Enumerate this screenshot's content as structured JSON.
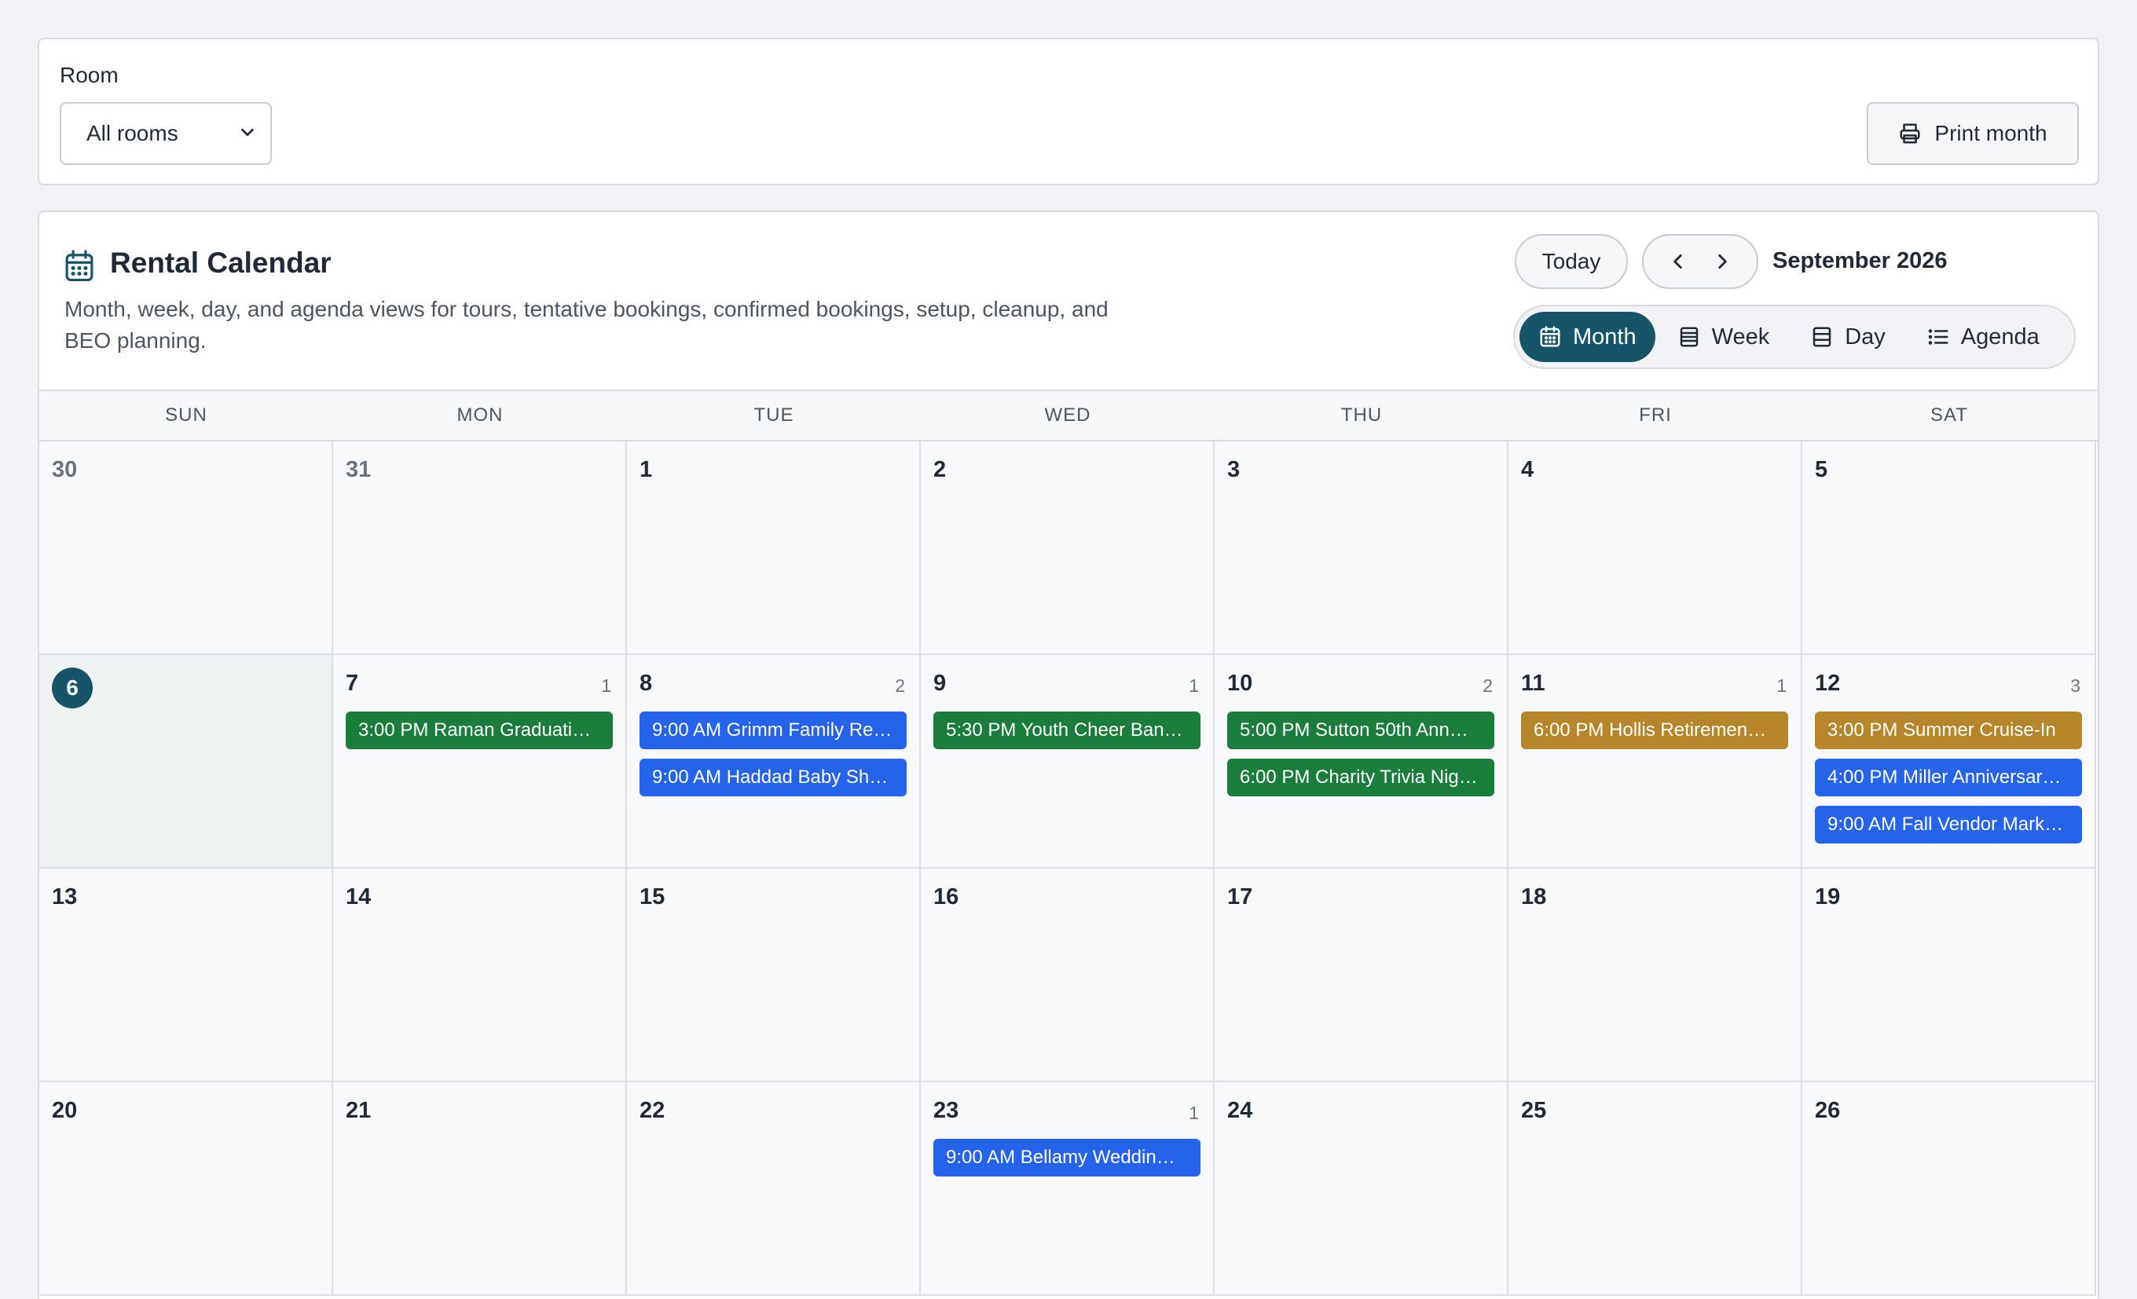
{
  "filter": {
    "room_label": "Room",
    "room_value": "All rooms",
    "print_label": "Print month"
  },
  "calendar": {
    "title": "Rental Calendar",
    "description": "Month, week, day, and agenda views for tours, tentative bookings, confirmed bookings, setup, cleanup, and BEO planning.",
    "today_label": "Today",
    "month_label": "September 2026",
    "views": [
      {
        "label": "Month",
        "icon": "calendar-icon",
        "active": true
      },
      {
        "label": "Week",
        "icon": "week-icon",
        "active": false
      },
      {
        "label": "Day",
        "icon": "day-icon",
        "active": false
      },
      {
        "label": "Agenda",
        "icon": "list-icon",
        "active": false
      }
    ],
    "weekdays": [
      "SUN",
      "MON",
      "TUE",
      "WED",
      "THU",
      "FRI",
      "SAT"
    ],
    "weeks": [
      [
        {
          "day": "30",
          "muted": true,
          "count": "",
          "events": []
        },
        {
          "day": "31",
          "muted": true,
          "count": "",
          "events": []
        },
        {
          "day": "1",
          "count": "",
          "events": []
        },
        {
          "day": "2",
          "count": "",
          "events": []
        },
        {
          "day": "3",
          "count": "",
          "events": []
        },
        {
          "day": "4",
          "count": "",
          "events": []
        },
        {
          "day": "5",
          "count": "",
          "events": []
        }
      ],
      [
        {
          "day": "6",
          "today": true,
          "count": "",
          "events": []
        },
        {
          "day": "7",
          "count": "1",
          "events": [
            {
              "label": "3:00 PM Raman Graduati…",
              "status": "confirmed"
            }
          ]
        },
        {
          "day": "8",
          "count": "2",
          "events": [
            {
              "label": "9:00 AM Grimm Family Re…",
              "status": "tentative"
            },
            {
              "label": "9:00 AM Haddad Baby Sh…",
              "status": "tentative"
            }
          ]
        },
        {
          "day": "9",
          "count": "1",
          "events": [
            {
              "label": "5:30 PM Youth Cheer Ban…",
              "status": "confirmed"
            }
          ]
        },
        {
          "day": "10",
          "count": "2",
          "events": [
            {
              "label": "5:00 PM Sutton 50th Ann…",
              "status": "confirmed"
            },
            {
              "label": "6:00 PM Charity Trivia Nig…",
              "status": "confirmed"
            }
          ]
        },
        {
          "day": "11",
          "count": "1",
          "events": [
            {
              "label": "6:00 PM Hollis Retiremen…",
              "status": "tour"
            }
          ]
        },
        {
          "day": "12",
          "count": "3",
          "events": [
            {
              "label": "3:00 PM Summer Cruise-In",
              "status": "tour"
            },
            {
              "label": "4:00 PM Miller Anniversar…",
              "status": "tentative"
            },
            {
              "label": "9:00 AM Fall Vendor Mark…",
              "status": "tentative"
            }
          ]
        }
      ],
      [
        {
          "day": "13",
          "count": "",
          "events": []
        },
        {
          "day": "14",
          "count": "",
          "events": []
        },
        {
          "day": "15",
          "count": "",
          "events": []
        },
        {
          "day": "16",
          "count": "",
          "events": []
        },
        {
          "day": "17",
          "count": "",
          "events": []
        },
        {
          "day": "18",
          "count": "",
          "events": []
        },
        {
          "day": "19",
          "count": "",
          "events": []
        }
      ],
      [
        {
          "day": "20",
          "count": "",
          "events": []
        },
        {
          "day": "21",
          "count": "",
          "events": []
        },
        {
          "day": "22",
          "count": "",
          "events": []
        },
        {
          "day": "23",
          "count": "1",
          "events": [
            {
              "label": "9:00 AM Bellamy Weddin…",
              "status": "tentative"
            }
          ]
        },
        {
          "day": "24",
          "count": "",
          "events": []
        },
        {
          "day": "25",
          "count": "",
          "events": []
        },
        {
          "day": "26",
          "count": "",
          "events": []
        }
      ]
    ]
  },
  "colors": {
    "accent": "#155469",
    "confirmed": "#1a7d3c",
    "tentative": "#2563eb",
    "tour": "#b7862b"
  }
}
